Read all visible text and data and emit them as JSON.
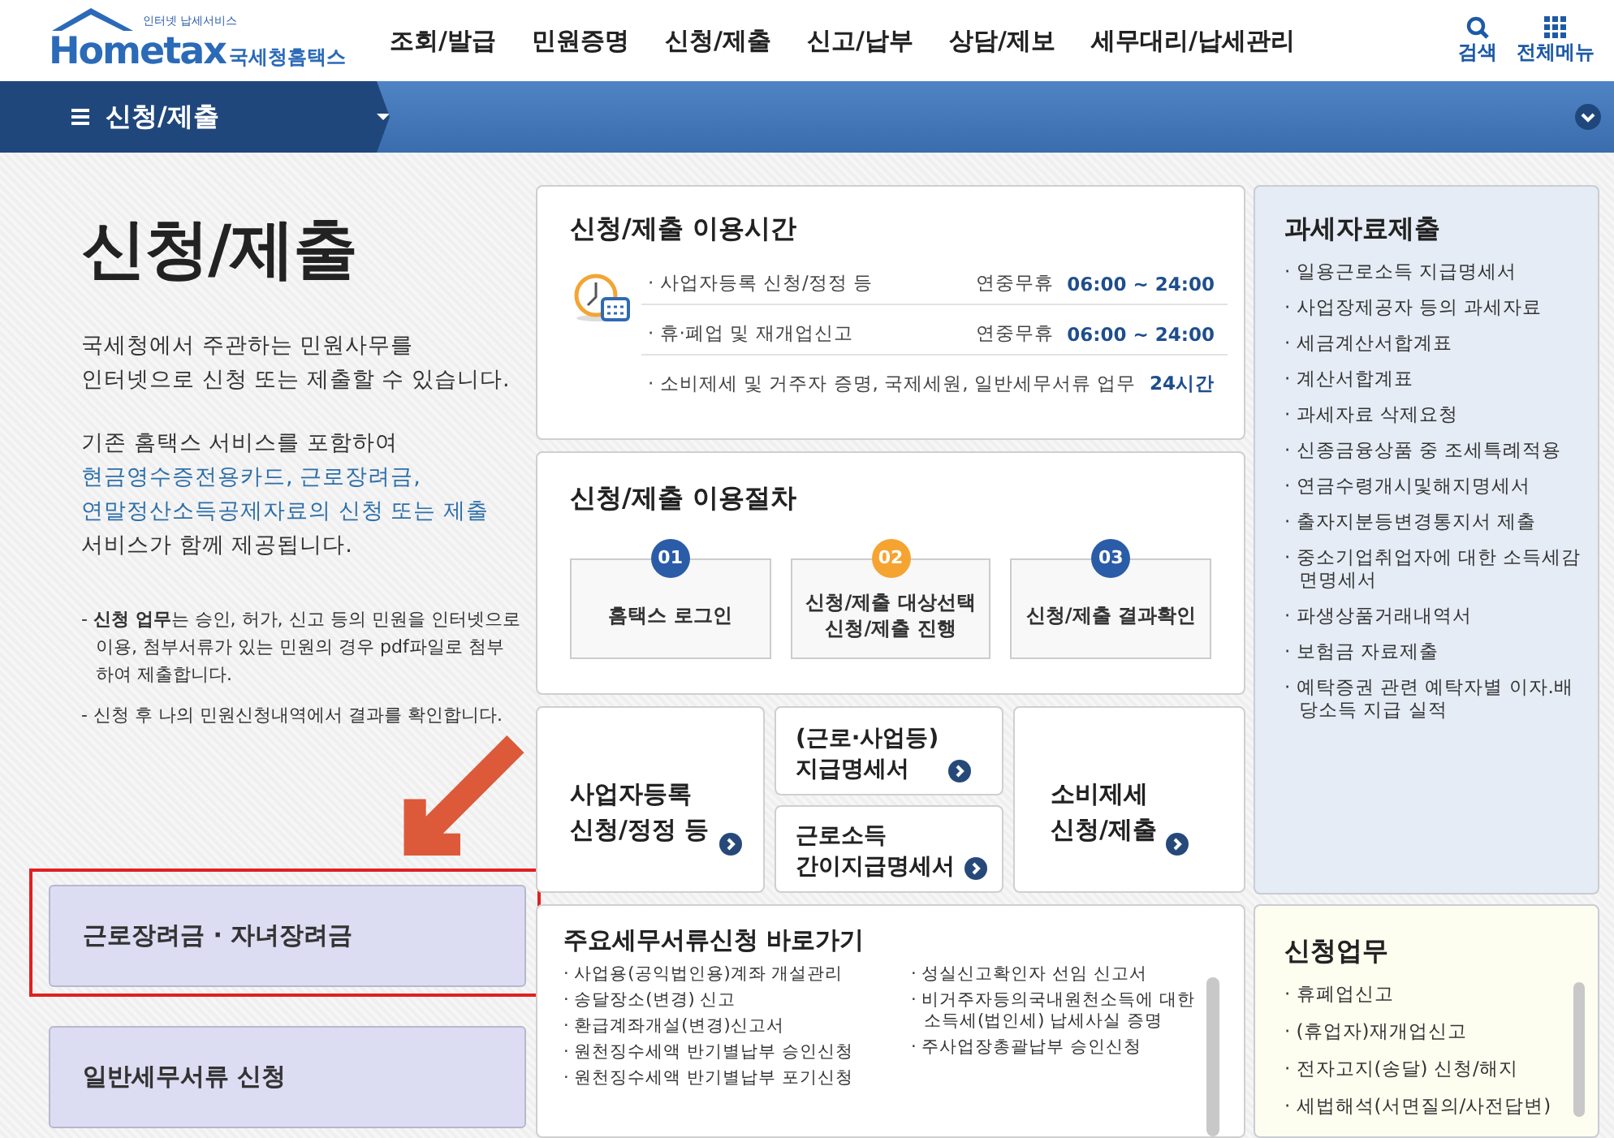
{
  "header": {
    "logo_tagline": "인터넷 납세서비스",
    "logo_text": "Hometax",
    "logo_korean": "국세청홈택스",
    "menu": [
      {
        "label": "조회/발급"
      },
      {
        "label": "민원증명"
      },
      {
        "label": "신청/제출"
      },
      {
        "label": "신고/납부"
      },
      {
        "label": "상담/제보"
      },
      {
        "label": "세무대리/납세관리"
      }
    ],
    "search_label": "검색",
    "all_menu_label": "전체메뉴"
  },
  "subnav": {
    "label": "신청/제출"
  },
  "intro": {
    "title": "신청/제출",
    "paragraph_1": "국세청에서 주관하는 민원사무를\n인터넷으로 신청 또는 제출할 수 있습니다.",
    "paragraph_2": {
      "before": "기존 홈택스 서비스를 포함하여\n",
      "highlight": "현금영수증전용카드, 근로장려금,\n연말정산소득공제자료의 신청 또는 제출",
      "after": "\n서비스가 함께 제공됩니다."
    },
    "notes": [
      "- **신청 업무**는 승인, 허가, 신고 등의 민원을 인터넷으로 이용, 첨부서류가 있는 민원의 경우 pdf파일로 첨부하여 제출합니다.",
      "- 신청 후 나의 민원신청내역에서 결과를 확인합니다."
    ]
  },
  "quick_buttons": [
    {
      "label": "근로장려금 · 자녀장려금",
      "highlighted": true
    },
    {
      "label": "일반세무서류 신청",
      "highlighted": false
    }
  ],
  "hours": {
    "title": "신청/제출 이용시간",
    "rows": [
      {
        "label": "· 사업자등록 신청/정정 등",
        "note": "연중무휴",
        "time": "06:00 ~ 24:00"
      },
      {
        "label": "· 휴·폐업 및 재개업신고",
        "note": "연중무휴",
        "time": "06:00 ~ 24:00"
      },
      {
        "label": "· 소비제세 및 거주자 증명, 국제세원, 일반세무서류 업무",
        "time": "24시간"
      }
    ]
  },
  "procedure": {
    "title": "신청/제출 이용절차",
    "steps": [
      {
        "number": "01",
        "label": "홈택스 로그인",
        "highlighted": false
      },
      {
        "number": "02",
        "label": "신청/제출 대상선택\n신청/제출 진행",
        "highlighted": true
      },
      {
        "number": "03",
        "label": "신청/제출 결과확인",
        "highlighted": false
      }
    ]
  },
  "tiles": [
    {
      "label": "사업자등록\n신청/정정 등"
    },
    {
      "label": "(근로·사업등)\n지급명세서"
    },
    {
      "label": "근로소득\n간이지급명세서"
    },
    {
      "label": "소비제세\n신청/제출"
    }
  ],
  "shortcuts": {
    "title": "주요세무서류신청 바로가기",
    "columns": [
      [
        "· 사업용(공익법인용)계좌 개설관리",
        "· 송달장소(변경) 신고",
        "· 환급계좌개설(변경)신고서",
        "· 원천징수세액 반기별납부 승인신청",
        "· 원천징수세액 반기별납부 포기신청"
      ],
      [
        "· 성실신고확인자 선임 신고서",
        "· 비거주자등의국내원천소득에 대한 소득세(법인세) 납세사실 증명",
        "· 주사업장총괄납부 승인신청"
      ]
    ]
  },
  "tax_data_panel": {
    "title": "과세자료제출",
    "items": [
      "· 일용근로소득 지급명세서",
      "· 사업장제공자 등의 과세자료",
      "· 세금계산서합계표",
      "· 계산서합계표",
      "· 과세자료 삭제요청",
      "· 신종금융상품 중 조세특례적용",
      "· 연금수령개시및해지명세서",
      "· 출자지분등변경통지서 제출",
      "· 중소기업취업자에 대한 소득세감면명세서",
      "· 파생상품거래내역서",
      "· 보험금 자료제출",
      "· 예탁증권 관련 예탁자별 이자.배당소득 지급 실적"
    ]
  },
  "application_panel": {
    "title": "신청업무",
    "items": [
      "· 휴폐업신고",
      "· (휴업자)재개업신고",
      "· 전자고지(송달) 신청/해지",
      "· 세법해석(서면질의/사전답변)"
    ]
  }
}
